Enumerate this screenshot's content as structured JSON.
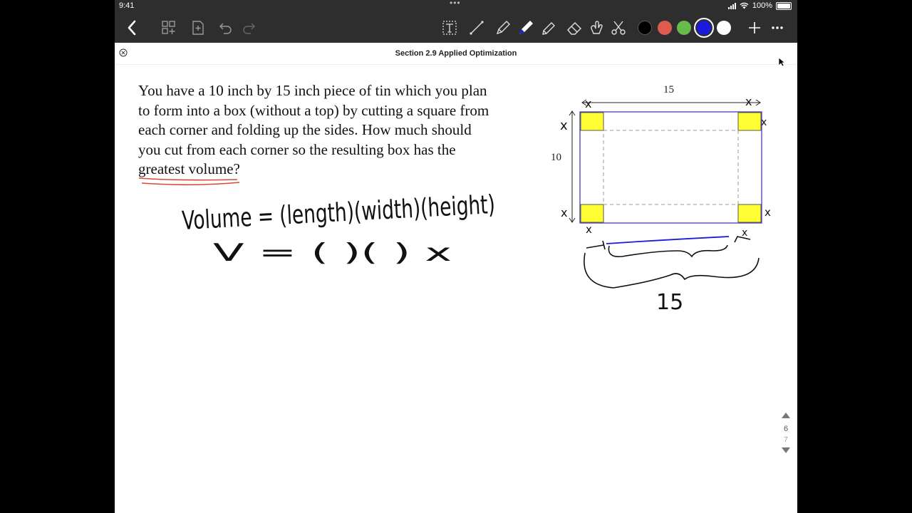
{
  "status": {
    "time": "9:41",
    "battery": "100%"
  },
  "toolbar": {
    "swatches": {
      "black": "#000000",
      "red": "#e05a4f",
      "green": "#66bb4a",
      "blue": "#1b1bdc",
      "white": "#ffffff"
    }
  },
  "document": {
    "title": "Section 2.9 Applied Optimization"
  },
  "problem": {
    "line1": "You have a 10 inch by 15 inch piece of tin which you plan",
    "line2": "to form into a box (without a top) by cutting a square from",
    "line3": "each corner and folding up the sides.  How much should",
    "line4": "you cut from each corner so the resulting box has the",
    "line5_underlined": "greatest volume",
    "line5_end": "?"
  },
  "diagram": {
    "top_label": "15",
    "side_label": "10",
    "corner_color": "#ffff33"
  },
  "handwriting": {
    "formula": "Volume = (length)(width)(height)",
    "v_line": "V = (          )(          ) x",
    "corner_marks": [
      "x",
      "x",
      "x",
      "x",
      "x",
      "x",
      "x",
      "x"
    ],
    "bottom_label": "15"
  },
  "pagenav": {
    "current": "6",
    "next": "7"
  }
}
